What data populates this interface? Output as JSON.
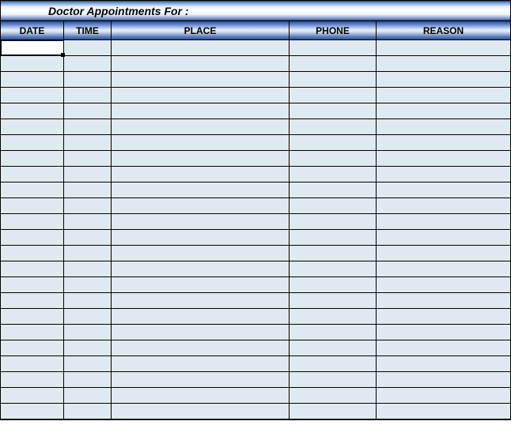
{
  "title": "Doctor Appointments  For :",
  "columns": [
    {
      "key": "date",
      "label": "DATE",
      "cls": "col-date"
    },
    {
      "key": "time",
      "label": "TIME",
      "cls": "col-time"
    },
    {
      "key": "place",
      "label": "PLACE",
      "cls": "col-place"
    },
    {
      "key": "phone",
      "label": "PHONE",
      "cls": "col-phone"
    },
    {
      "key": "reason",
      "label": "REASON",
      "cls": "col-reason"
    }
  ],
  "rows": [
    {
      "date": "",
      "time": "",
      "place": "",
      "phone": "",
      "reason": ""
    },
    {
      "date": "",
      "time": "",
      "place": "",
      "phone": "",
      "reason": ""
    },
    {
      "date": "",
      "time": "",
      "place": "",
      "phone": "",
      "reason": ""
    },
    {
      "date": "",
      "time": "",
      "place": "",
      "phone": "",
      "reason": ""
    },
    {
      "date": "",
      "time": "",
      "place": "",
      "phone": "",
      "reason": ""
    },
    {
      "date": "",
      "time": "",
      "place": "",
      "phone": "",
      "reason": ""
    },
    {
      "date": "",
      "time": "",
      "place": "",
      "phone": "",
      "reason": ""
    },
    {
      "date": "",
      "time": "",
      "place": "",
      "phone": "",
      "reason": ""
    },
    {
      "date": "",
      "time": "",
      "place": "",
      "phone": "",
      "reason": ""
    },
    {
      "date": "",
      "time": "",
      "place": "",
      "phone": "",
      "reason": ""
    },
    {
      "date": "",
      "time": "",
      "place": "",
      "phone": "",
      "reason": ""
    },
    {
      "date": "",
      "time": "",
      "place": "",
      "phone": "",
      "reason": ""
    },
    {
      "date": "",
      "time": "",
      "place": "",
      "phone": "",
      "reason": ""
    },
    {
      "date": "",
      "time": "",
      "place": "",
      "phone": "",
      "reason": ""
    },
    {
      "date": "",
      "time": "",
      "place": "",
      "phone": "",
      "reason": ""
    },
    {
      "date": "",
      "time": "",
      "place": "",
      "phone": "",
      "reason": ""
    },
    {
      "date": "",
      "time": "",
      "place": "",
      "phone": "",
      "reason": ""
    },
    {
      "date": "",
      "time": "",
      "place": "",
      "phone": "",
      "reason": ""
    },
    {
      "date": "",
      "time": "",
      "place": "",
      "phone": "",
      "reason": ""
    },
    {
      "date": "",
      "time": "",
      "place": "",
      "phone": "",
      "reason": ""
    },
    {
      "date": "",
      "time": "",
      "place": "",
      "phone": "",
      "reason": ""
    },
    {
      "date": "",
      "time": "",
      "place": "",
      "phone": "",
      "reason": ""
    },
    {
      "date": "",
      "time": "",
      "place": "",
      "phone": "",
      "reason": ""
    },
    {
      "date": "",
      "time": "",
      "place": "",
      "phone": "",
      "reason": ""
    }
  ],
  "active_cell": {
    "row": 0,
    "col": 0
  }
}
